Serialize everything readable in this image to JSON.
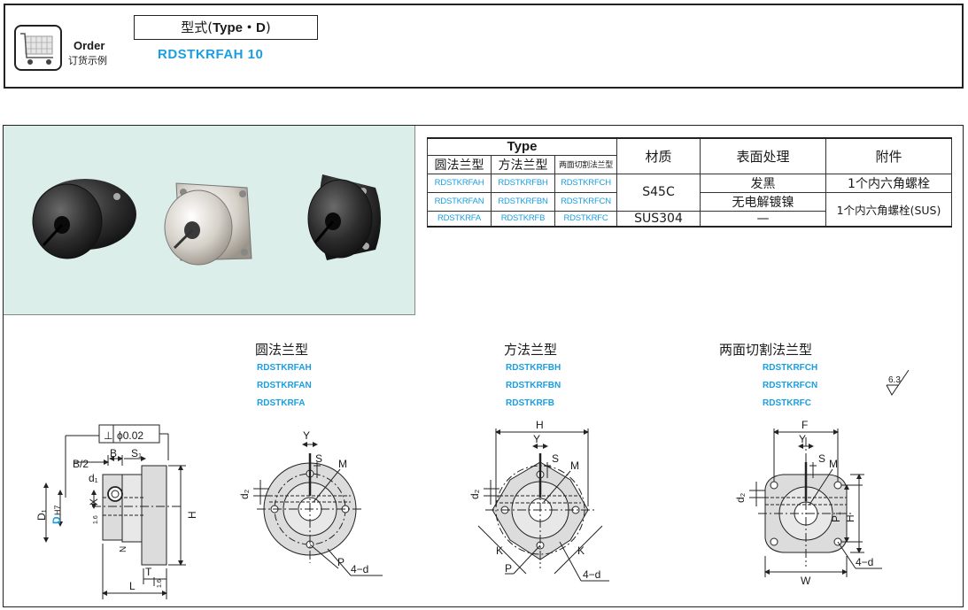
{
  "order": {
    "label_en": "Order",
    "label_cn": "订货示例",
    "type_prefix": "型式(",
    "type_code": "Type・D",
    "type_suffix": ")",
    "example_code": "RDSTKRFAH  10"
  },
  "spec_table": {
    "type_header": "Type",
    "type_subheaders": [
      "圆法兰型",
      "方法兰型",
      "两面切割法兰型"
    ],
    "material_header": "材质",
    "surface_header": "表面处理",
    "accessory_header": "附件",
    "rows": [
      {
        "codes": [
          "RDSTKRFAH",
          "RDSTKRFBH",
          "RDSTKRFCH"
        ],
        "surface": "发黑",
        "accessory": "1个内六角螺栓"
      },
      {
        "codes": [
          "RDSTKRFAN",
          "RDSTKRFBN",
          "RDSTKRFCN"
        ],
        "surface": "无电解镀镍",
        "accessory": "1个内六角螺栓(SUS)"
      },
      {
        "codes": [
          "RDSTKRFA",
          "RDSTKRFB",
          "RDSTKRFC"
        ],
        "surface": "—",
        "material": "SUS304"
      }
    ],
    "material_s45c": "S45C"
  },
  "drawings": {
    "round": {
      "title": "圆法兰型",
      "codes": [
        "RDSTKRFAH",
        "RDSTKRFAN",
        "RDSTKRFA"
      ]
    },
    "square": {
      "title": "方法兰型",
      "codes": [
        "RDSTKRFBH",
        "RDSTKRFBN",
        "RDSTKRFB"
      ]
    },
    "two_cut": {
      "title": "两面切割法兰型",
      "codes": [
        "RDSTKRFCH",
        "RDSTKRFCN",
        "RDSTKRFC"
      ]
    },
    "roughness": "6.3",
    "side_labels": {
      "perp": "⊥",
      "phi": "ϕ0.02",
      "b_half": "B/2",
      "b": "B",
      "s1": "S₁",
      "d1": "d₁",
      "D1": "D₁",
      "D": "D",
      "H7": "H7",
      "X": "X",
      "H": "H",
      "N": "N",
      "T": "T",
      "L": "L",
      "r16a": "1.6",
      "r16b": "1.6"
    },
    "round_labels": {
      "Y": "Y",
      "S": "S",
      "M": "M",
      "d2": "d₂",
      "P": "P",
      "d": "4−d"
    },
    "square_labels": {
      "H": "H",
      "Y": "Y",
      "S": "S",
      "M": "M",
      "d2": "d₂",
      "K1": "K",
      "K2": "K",
      "P": "P",
      "d": "4−d"
    },
    "cut_labels": {
      "F": "F",
      "Y": "Y",
      "S": "S",
      "M": "M",
      "d2": "d₂",
      "P1": "P₁",
      "H": "H",
      "W": "W",
      "d": "4−d"
    }
  },
  "colors": {
    "accent": "#1a9ee0",
    "photo_bg": "#dceee9"
  }
}
